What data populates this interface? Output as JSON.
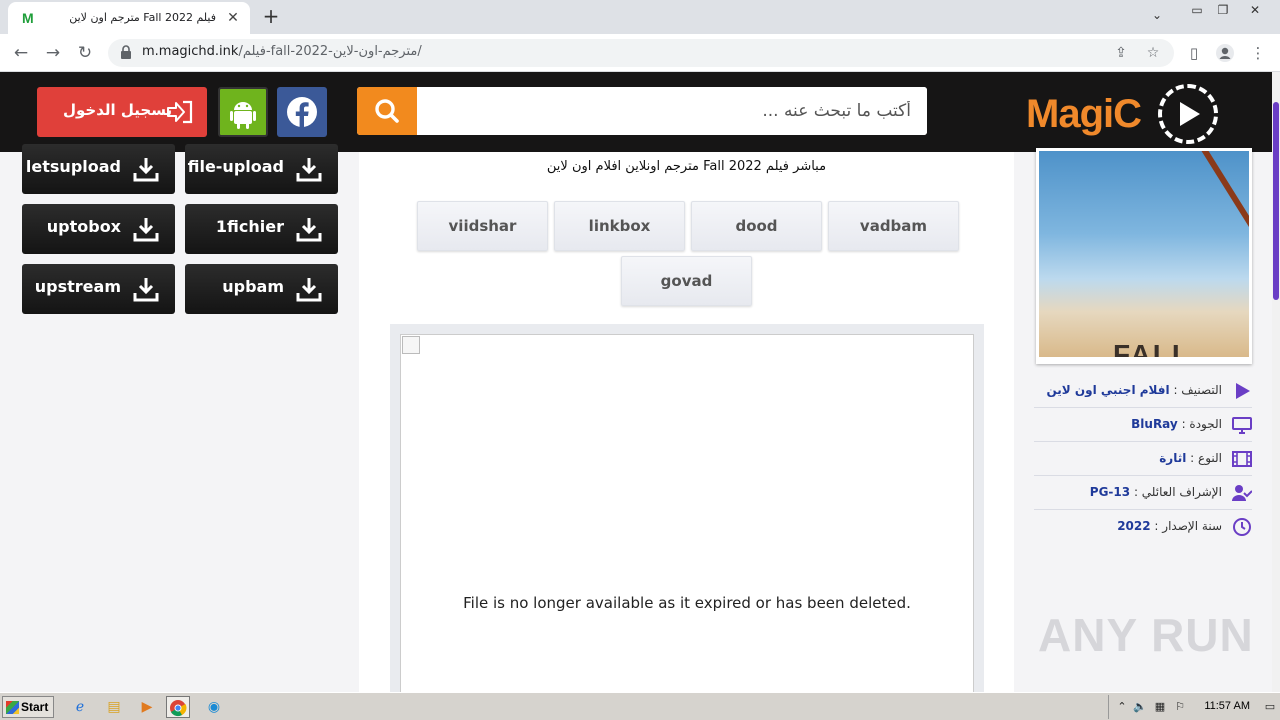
{
  "browser": {
    "tab_title": "فيلم Fall 2022 مترجم اون لاين",
    "tab_favicon": "M",
    "url_host": "m.magichd.ink",
    "url_path": "/فيلم-fall-2022-مترجم-اون-لاين/",
    "new_tab_symbol": "+"
  },
  "header": {
    "logo_text": "MagiC",
    "search_placeholder": "أكتب ما تبحث عنه ...",
    "login_label": "تسجيل الدخول"
  },
  "downloads": [
    {
      "name": "file-upload"
    },
    {
      "name": "letsupload"
    },
    {
      "name": "1fichier"
    },
    {
      "name": "uptobox"
    },
    {
      "name": "upbam"
    },
    {
      "name": "upstream"
    }
  ],
  "content": {
    "description_line": "مباشر فيلم Fall 2022 مترجم اونلاين افلام اون لاين",
    "servers": [
      "vadbam",
      "dood",
      "linkbox",
      "viidshar",
      "govad"
    ],
    "player_message": "File is no longer available as it expired or has been deleted."
  },
  "sidebar": {
    "poster_title": "FALL",
    "meta": [
      {
        "icon": "play-icon",
        "label": "التصنيف :",
        "value": "افلام اجنبي اون لاين"
      },
      {
        "icon": "monitor-icon",
        "label": "الجودة :",
        "value": "BluRay"
      },
      {
        "icon": "film-icon",
        "label": "النوع :",
        "value": "اثارة"
      },
      {
        "icon": "user-check-icon",
        "label": "الإشراف العائلي :",
        "value": "PG-13"
      },
      {
        "icon": "clock-icon",
        "label": "سنة الإصدار :",
        "value": "2022"
      }
    ]
  },
  "watermark": "ANY RUN",
  "taskbar": {
    "start_label": "Start",
    "clock": "11:57 AM"
  },
  "colors": {
    "header_bg": "#161515",
    "accent_orange": "#f28a1e",
    "login_red": "#e0403a",
    "facebook_blue": "#3b5998",
    "android_green": "#6fb41d",
    "meta_value_blue": "#1f3a9a",
    "icon_purple": "#6a3ec5"
  }
}
